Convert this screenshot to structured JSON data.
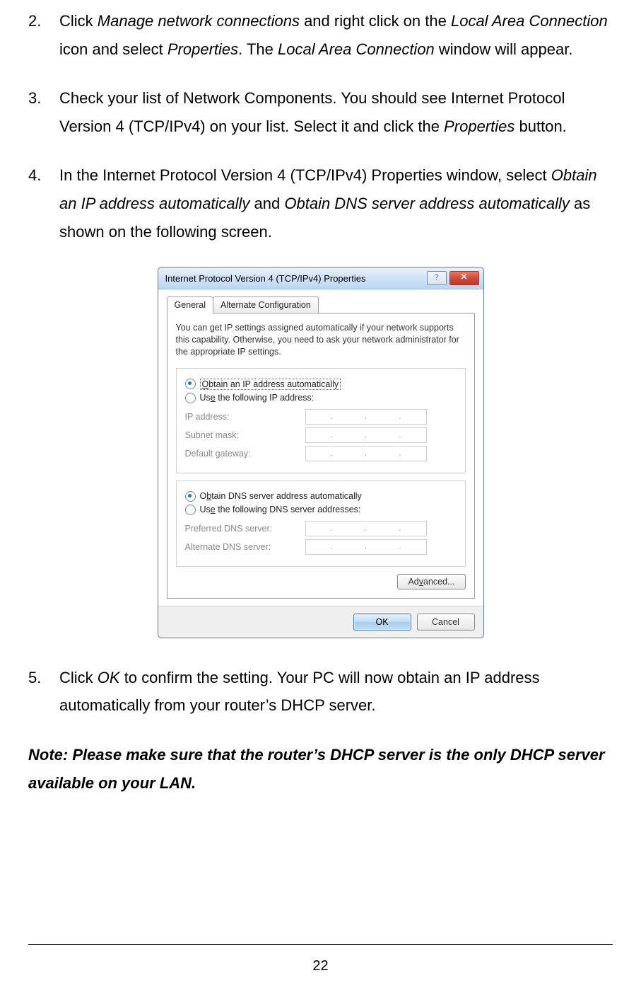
{
  "steps": {
    "s2": {
      "num": "2.",
      "parts": [
        {
          "t": "Click ",
          "i": false
        },
        {
          "t": "Manage network connections",
          "i": true
        },
        {
          "t": " and right click on the ",
          "i": false
        },
        {
          "t": "Local Area Connection",
          "i": true
        },
        {
          "t": " icon and select ",
          "i": false
        },
        {
          "t": "Properties",
          "i": true
        },
        {
          "t": ". The ",
          "i": false
        },
        {
          "t": "Local Area Connection",
          "i": true
        },
        {
          "t": " window will appear.",
          "i": false
        }
      ]
    },
    "s3": {
      "num": "3.",
      "parts": [
        {
          "t": "Check your list of Network Components. You should see Internet Protocol Version 4 (TCP/IPv4) on your list. Select it and click the ",
          "i": false
        },
        {
          "t": "Properties",
          "i": true
        },
        {
          "t": " button.",
          "i": false
        }
      ]
    },
    "s4": {
      "num": "4.",
      "parts": [
        {
          "t": "In the Internet Protocol Version 4 (TCP/IPv4) Properties window, select ",
          "i": false
        },
        {
          "t": "Obtain an IP address automatically",
          "i": true
        },
        {
          "t": " and ",
          "i": false
        },
        {
          "t": "Obtain DNS server address automatically",
          "i": true
        },
        {
          "t": " as shown on the following screen.",
          "i": false
        }
      ]
    },
    "s5": {
      "num": "5.",
      "parts": [
        {
          "t": "Click ",
          "i": false
        },
        {
          "t": "OK",
          "i": true
        },
        {
          "t": " to confirm the setting. Your PC will now obtain an IP address automatically from your router’s DHCP server.",
          "i": false
        }
      ]
    }
  },
  "note": "Note: Please make sure that the router’s DHCP server is the only DHCP server available on your LAN.",
  "page_number": "22",
  "dialog": {
    "title": "Internet Protocol Version 4 (TCP/IPv4) Properties",
    "help_glyph": "?",
    "close_glyph": "✕",
    "tabs": {
      "general": "General",
      "alt": "Alternate Configuration"
    },
    "helptext": "You can get IP settings assigned automatically if your network supports this capability. Otherwise, you need to ask your network administrator for the appropriate IP settings.",
    "ip": {
      "auto_label_pre": "O",
      "auto_label": "btain an IP address automatically",
      "manual_label_pre": "Us",
      "manual_label_u": "e",
      "manual_label_post": " the following IP address:",
      "fields": {
        "ip": "IP address:",
        "mask": "Subnet mask:",
        "gw": "Default gateway:"
      }
    },
    "dns": {
      "auto_label_pre": "O",
      "auto_label_u": "b",
      "auto_label_post": "tain DNS server address automatically",
      "manual_label_pre": "Us",
      "manual_label_u": "e",
      "manual_label_post": " the following DNS server addresses:",
      "fields": {
        "pref": "Preferred DNS server:",
        "alt": "Alternate DNS server:"
      }
    },
    "advanced_pre": "Ad",
    "advanced_u": "v",
    "advanced_post": "anced...",
    "ok": "OK",
    "cancel": "Cancel",
    "dots": "."
  }
}
